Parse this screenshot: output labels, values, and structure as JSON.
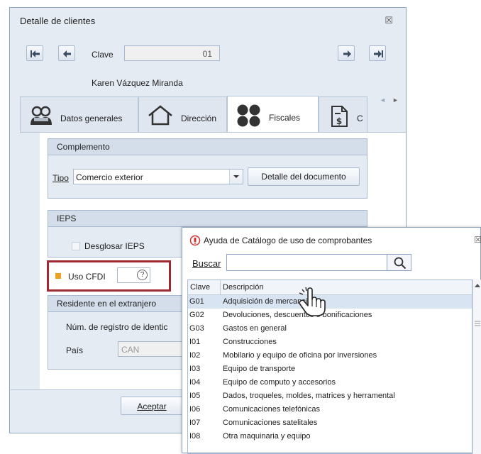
{
  "dialog": {
    "title": "Detalle de clientes",
    "close_glyph": "☒",
    "clave_label": "Clave",
    "clave_value": "01",
    "client_name": "Karen Vázquez Miranda",
    "nav_icons": [
      "first-record-icon",
      "previous-record-icon",
      "next-record-icon",
      "last-record-icon"
    ]
  },
  "tabs": [
    {
      "label": "Datos generales",
      "icon": "people-icon",
      "active": false
    },
    {
      "label": "Dirección",
      "icon": "house-icon",
      "active": false
    },
    {
      "label": "Fiscales",
      "icon": "dots-icon",
      "active": true
    },
    {
      "label": "C",
      "icon": "invoice-dollar-icon",
      "active": false
    }
  ],
  "tab_scroll": {
    "left": "◄",
    "right": "►"
  },
  "complemento": {
    "title": "Complemento",
    "tipo_label": "Tipo",
    "tipo_value": "Comercio exterior",
    "detalle_button": "Detalle del documento"
  },
  "ieps": {
    "title": "IEPS",
    "desglosar_label": "Desglosar IEPS"
  },
  "uso_cfdi": {
    "label": "Uso CFDI",
    "help_glyph": "?",
    "highlight_color": "#a02832",
    "marker_color": "#f0a020"
  },
  "residente": {
    "title": "Residente en el extranjero",
    "num_registro_label": "Núm. de registro de identic",
    "pais_label": "País",
    "pais_value": "CAN"
  },
  "footer": {
    "aceptar_label": "Aceptar"
  },
  "popup": {
    "title": "Ayuda de Catálogo de uso de comprobantes",
    "close_glyph": "☒",
    "buscar_label": "Buscar",
    "buscar_value": "",
    "columns": [
      "Clave",
      "Descripción"
    ],
    "rows": [
      {
        "clave": "G01",
        "descripcion": "Adquisición de mercancias"
      },
      {
        "clave": "G02",
        "descripcion": "Devoluciones, descuentos o bonificaciones"
      },
      {
        "clave": "G03",
        "descripcion": "Gastos en general"
      },
      {
        "clave": "I01",
        "descripcion": "Construcciones"
      },
      {
        "clave": "I02",
        "descripcion": "Mobilario y equipo de oficina por inversiones"
      },
      {
        "clave": "I03",
        "descripcion": "Equipo de transporte"
      },
      {
        "clave": "I04",
        "descripcion": "Equipo de computo y accesorios"
      },
      {
        "clave": "I05",
        "descripcion": "Dados, troqueles, moldes, matrices y herramental"
      },
      {
        "clave": "I06",
        "descripcion": "Comunicaciones telefónicas"
      },
      {
        "clave": "I07",
        "descripcion": "Comunicaciones satelitales"
      },
      {
        "clave": "I08",
        "descripcion": "Otra maquinaria y equipo"
      }
    ]
  }
}
